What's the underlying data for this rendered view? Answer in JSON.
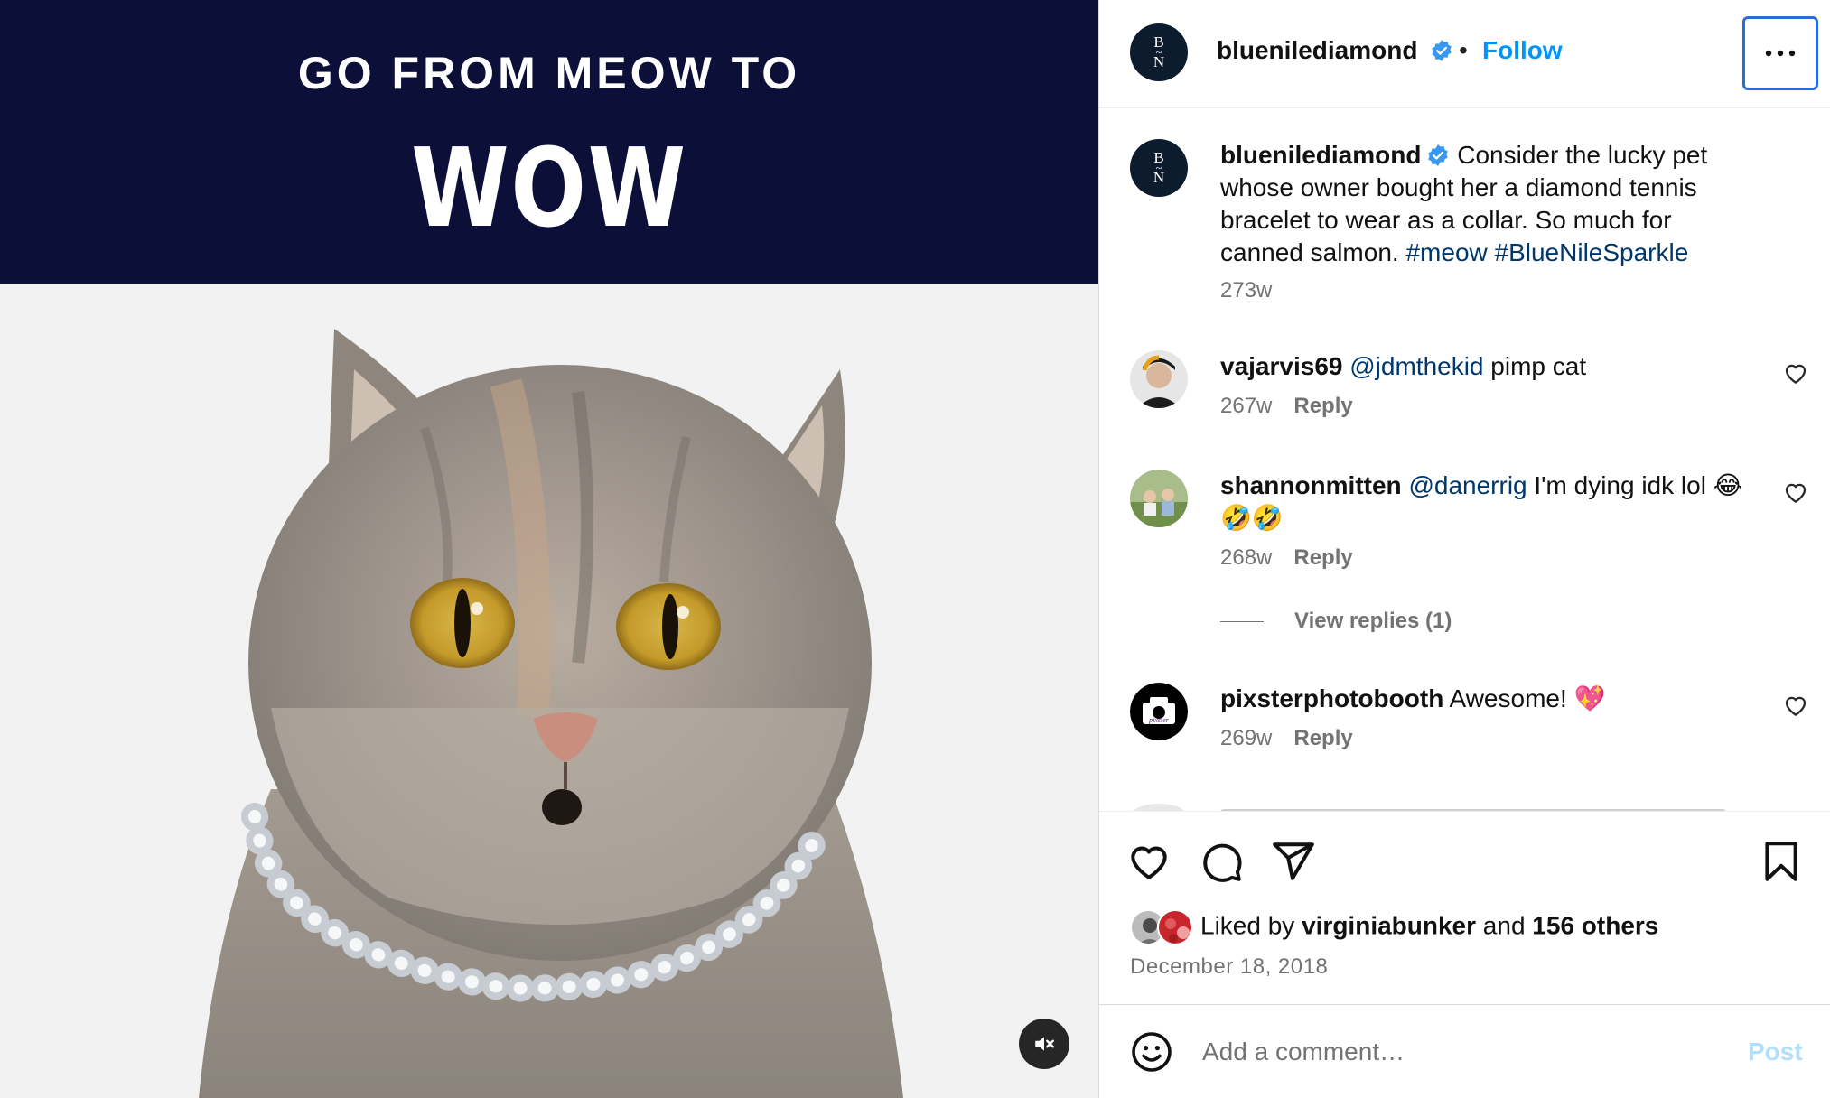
{
  "media": {
    "banner_line1": "GO FROM MEOW TO",
    "banner_line2": "WOW",
    "mute_icon": "volume-muted-icon"
  },
  "header": {
    "avatar_top": "B",
    "avatar_bottom": "N",
    "username": "bluenilediamond",
    "dot": "•",
    "follow_label": "Follow",
    "more_icon": "more-horizontal-icon"
  },
  "caption": {
    "username": "bluenilediamond",
    "text": " Consider the lucky pet whose owner bought her a diamond tennis bracelet to wear as a collar. So much for canned salmon. ",
    "tag1": "#meow",
    "tag2": "#BlueNileSparkle",
    "time": "273w"
  },
  "comments": [
    {
      "username": "vajarvis69",
      "mention": "@jdmthekid",
      "text": " pimp cat",
      "time": "267w",
      "reply": "Reply"
    },
    {
      "username": "shannonmitten",
      "mention": "@danerrig",
      "text": " I'm dying idk lol 😂🤣🤣",
      "time": "268w",
      "reply": "Reply",
      "view_replies": "View replies (1)"
    },
    {
      "username": "pixsterphotobooth",
      "mention": "",
      "text": " Awesome! 💖",
      "time": "269w",
      "reply": "Reply",
      "avatar_label": "pixster"
    }
  ],
  "actions": {
    "icons": [
      "heart-icon",
      "comment-icon",
      "share-icon",
      "bookmark-icon"
    ],
    "liked_prefix": "Liked by ",
    "liked_user": "virginiabunker",
    "liked_mid": " and ",
    "liked_others": "156 others",
    "date": "December 18, 2018"
  },
  "composer": {
    "placeholder": "Add a comment…",
    "post_label": "Post",
    "emoji_icon": "smiley-icon"
  },
  "colors": {
    "banner": "#0c0f38",
    "link_blue": "#0095f6",
    "hashtag": "#00376b",
    "meta_gray": "#737373",
    "post_disabled": "#b2dffc"
  }
}
